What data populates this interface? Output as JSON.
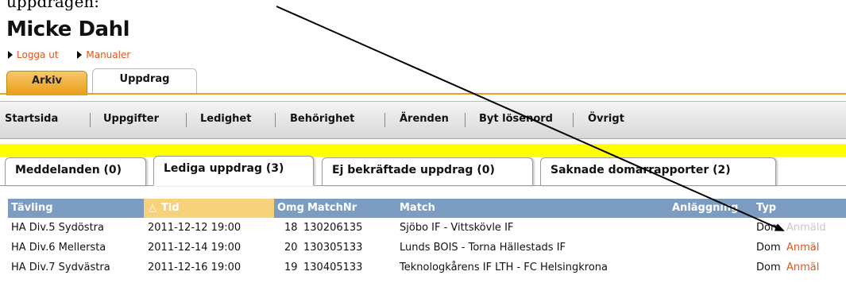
{
  "caption": "uppdragen:",
  "user_name": "Micke Dahl",
  "top_links": [
    "Logga ut",
    "Manualer"
  ],
  "main_tabs": [
    "Arkiv",
    "Uppdrag"
  ],
  "menu_items": [
    "Startsida",
    "Uppgifter",
    "Ledighet",
    "Behörighet",
    "Ärenden",
    "Byt lösenord",
    "Övrigt"
  ],
  "sub_tabs": [
    "Meddelanden (0)",
    "Lediga uppdrag (3)",
    "Ej bekräftade uppdrag (0)",
    "Saknade domarrapporter (2)"
  ],
  "table": {
    "headers": {
      "tavling": "Tävling",
      "tid": "Tid",
      "tid_sort_icon": "△",
      "omg": "Omg",
      "matchnr": "MatchNr",
      "match": "Match",
      "anlaggning": "Anläggning",
      "typ": "Typ"
    },
    "rows": [
      {
        "tavling": "HA Div.5 Sydöstra",
        "tid": "2011-12-12 19:00",
        "omg": "18",
        "matchnr": "130206135",
        "match": "Sjöbo IF - Vittskövle IF",
        "typ": "Dom",
        "action": "Anmäld",
        "action_state": "disabled"
      },
      {
        "tavling": "HA Div.6 Mellersta",
        "tid": "2011-12-14 19:00",
        "omg": "20",
        "matchnr": "130305133",
        "match": "Lunds BOIS - Torna Hällestads IF",
        "typ": "Dom",
        "action": "Anmäl",
        "action_state": "enabled"
      },
      {
        "tavling": "HA Div.7 Sydvästra",
        "tid": "2011-12-16 19:00",
        "omg": "19",
        "matchnr": "130405133",
        "match": "Teknologkårens IF LTH - FC Helsingkrona",
        "typ": "Dom",
        "action": "Anmäl",
        "action_state": "enabled"
      }
    ]
  },
  "colors": {
    "accent_orange": "#e99c17",
    "link_orange": "#e2541b",
    "table_header": "#7c9cc2",
    "highlight_bar": "#ffff00"
  }
}
